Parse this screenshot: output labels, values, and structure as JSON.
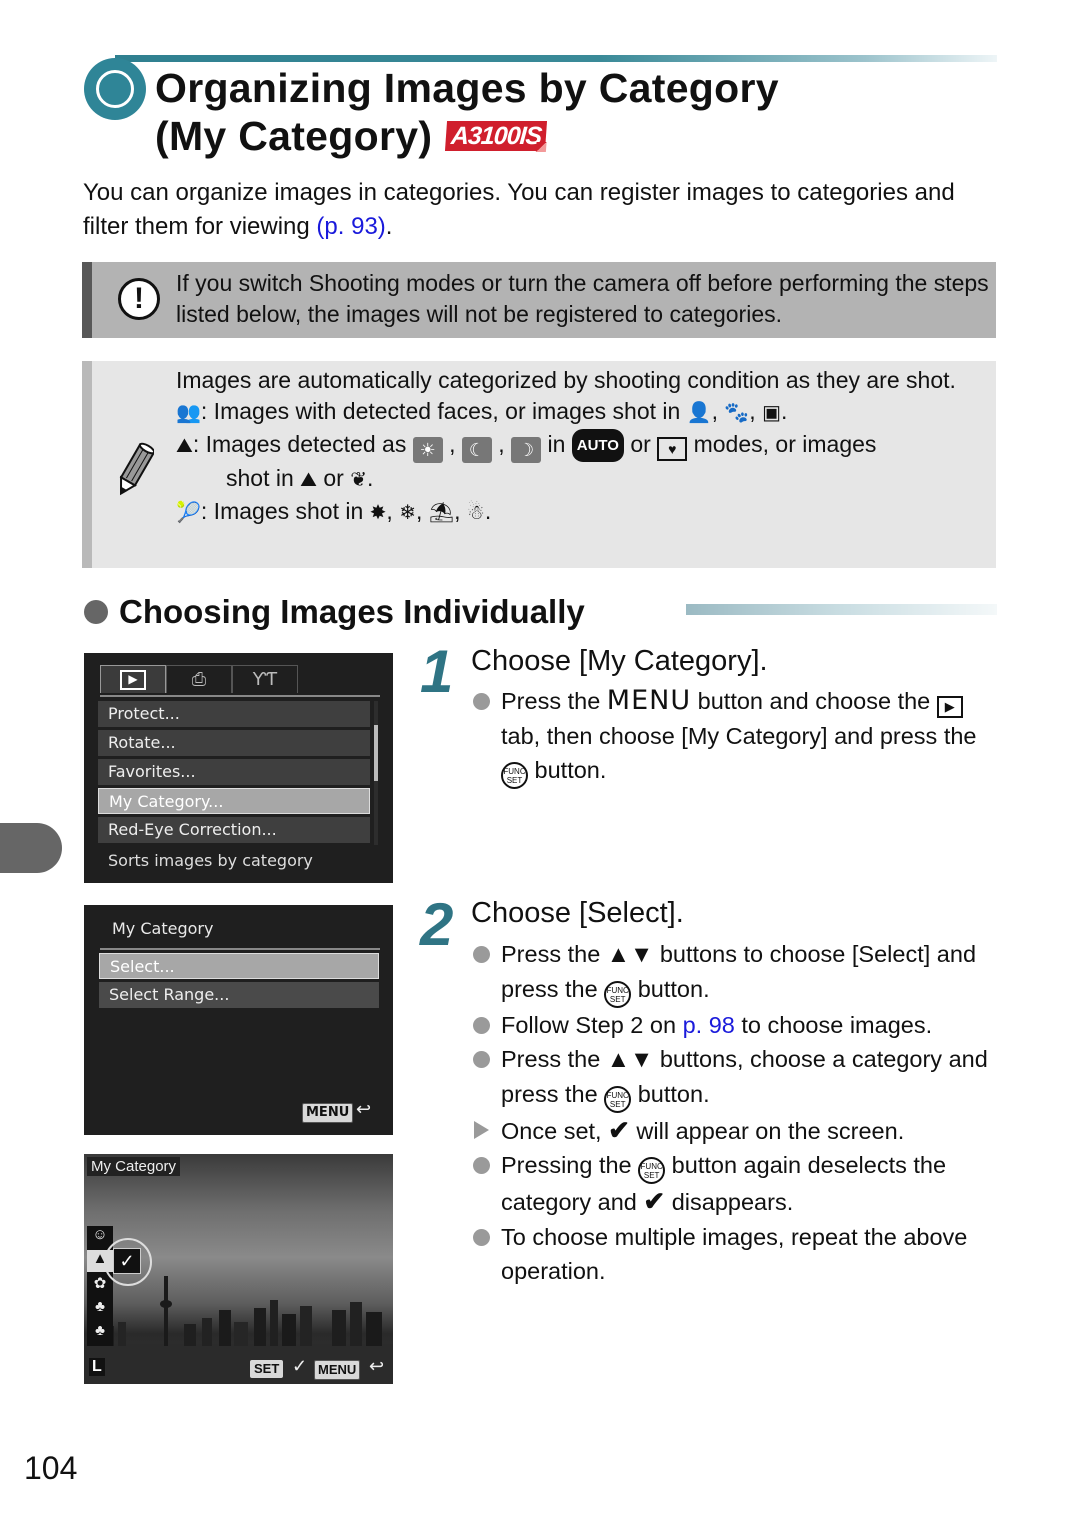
{
  "header": {
    "title_line1": "Organizing Images by Category",
    "title_line2": "(My Category)",
    "model_badge": "A3100IS",
    "accent_color": "#2f8597",
    "badge_color": "#d01f2d"
  },
  "intro": {
    "text": "You can organize images in categories. You can register images to categories and filter them for viewing ",
    "link": "(p. 93)",
    "end": "."
  },
  "caution": {
    "icon": "caution-icon",
    "text": "If you switch Shooting modes or turn the camera off before performing the steps listed below, the images will not be registered to categories."
  },
  "note": {
    "icon": "pencil-icon",
    "intro": "Images are automatically categorized by shooting condition as they are shot.",
    "people": {
      "icon": "people-category-icon",
      "text": ": Images with detected faces, or images shot in ",
      "mode_icons": [
        "portrait-mode-icon",
        "kids-pets-mode-icon",
        "smart-shutter-mode-icon"
      ]
    },
    "scenery": {
      "icon": "scenery-category-icon",
      "text1": ": Images detected as ",
      "scene_icons": [
        "sunset-scene-icon",
        "night-scene-icon",
        "night-portrait-scene-icon"
      ],
      "text2": " in ",
      "auto_label": "AUTO",
      "text3": " or ",
      "text4": " modes, or images",
      "text5": "shot in ",
      "text6": " or ",
      "end": "."
    },
    "events": {
      "icon": "events-category-icon",
      "text": ": Images shot in ",
      "mode_icons": [
        "fireworks-mode-icon",
        "snow-mode-icon",
        "beach-mode-icon",
        "snowman-mode-icon"
      ]
    }
  },
  "section": {
    "title": "Choosing Images Individually"
  },
  "screen1": {
    "tabs": [
      "play-tab",
      "print-tab",
      "settings-tab"
    ],
    "items": [
      "Protect...",
      "Rotate...",
      "Favorites...",
      "My Category...",
      "Red-Eye Correction..."
    ],
    "selected_index": 3,
    "help": "Sorts images by category",
    "scroll_position": 0.2
  },
  "screen2": {
    "heading": "My Category",
    "items": [
      "Select...",
      "Select Range..."
    ],
    "selected_index": 0,
    "menu_label": "MENU"
  },
  "screen3": {
    "heading": "My Category",
    "categories": [
      "people",
      "scenery",
      "events",
      "category-1",
      "category-2"
    ],
    "checked_category": "scenery",
    "set_label": "SET",
    "menu_label": "MENU",
    "size_label": "L"
  },
  "steps": [
    {
      "number": "1",
      "title": "Choose [My Category].",
      "bullets": {
        "b1_a": "Press the ",
        "b1_menu": "MENU",
        "b1_b": " button and choose the ",
        "b1_c": " tab, then choose [My Category] and press the ",
        "b1_d": " button."
      }
    },
    {
      "number": "2",
      "title": "Choose [Select].",
      "bullets": {
        "b1_a": "Press the ",
        "b1_arrows": "▲▼",
        "b1_b": " buttons to choose [Select] and press the ",
        "b1_c": " button.",
        "b2_a": "Follow Step 2 on ",
        "b2_link": "p. 98",
        "b2_b": " to choose images.",
        "b3_a": "Press the ",
        "b3_arrows": "▲▼",
        "b3_b": " buttons, choose a category and press the ",
        "b3_c": " button.",
        "b4_a": "Once set, ",
        "b4_check": "✔",
        "b4_b": " will appear on the screen.",
        "b5_a": "Pressing the ",
        "b5_b": " button again deselects the category and ",
        "b5_check": "✔",
        "b5_c": " disappears.",
        "b6": "To choose multiple images, repeat the above operation."
      }
    }
  ],
  "func_label_top": "FUNC",
  "func_label_bottom": "SET",
  "page_number": "104"
}
